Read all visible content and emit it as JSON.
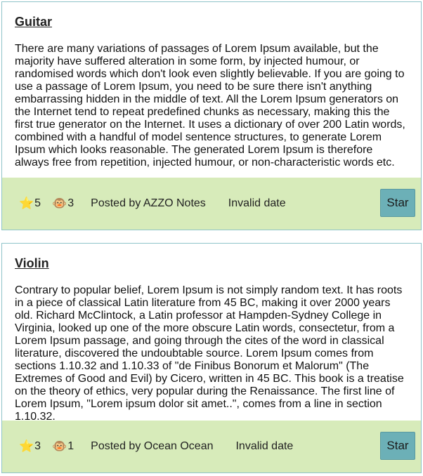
{
  "posts": [
    {
      "title": "Guitar",
      "body": "There are many variations of passages of Lorem Ipsum available, but the majority have suffered alteration in some form, by injected humour, or randomised words which don't look even slightly believable. If you are going to use a passage of Lorem Ipsum, you need to be sure there isn't anything embarrassing hidden in the middle of text. All the Lorem Ipsum generators on the Internet tend to repeat predefined chunks as necessary, making this the first true generator on the Internet. It uses a dictionary of over 200 Latin words, combined with a handful of model sentence structures, to generate Lorem Ipsum which looks reasonable. The generated Lorem Ipsum is therefore always free from repetition, injected humour, or non-characteristic words etc.",
      "star_emoji": "⭐",
      "stars": "5",
      "monkey_emoji": "🐵",
      "monkeys": "3",
      "posted_by": "Posted by AZZO Notes",
      "date": "Invalid date",
      "star_button": "Star"
    },
    {
      "title": "Violin",
      "body": "Contrary to popular belief, Lorem Ipsum is not simply random text. It has roots in a piece of classical Latin literature from 45 BC, making it over 2000 years old. Richard McClintock, a Latin professor at Hampden-Sydney College in Virginia, looked up one of the more obscure Latin words, consectetur, from a Lorem Ipsum passage, and going through the cites of the word in classical literature, discovered the undoubtable source. Lorem Ipsum comes from sections 1.10.32 and 1.10.33 of \"de Finibus Bonorum et Malorum\" (The Extremes of Good and Evil) by Cicero, written in 45 BC. This book is a treatise on the theory of ethics, very popular during the Renaissance. The first line of Lorem Ipsum, \"Lorem ipsum dolor sit amet..\", comes from a line in section 1.10.32.",
      "star_emoji": "⭐",
      "stars": "3",
      "monkey_emoji": "🐵",
      "monkeys": "1",
      "posted_by": "Posted by Ocean Ocean",
      "date": "Invalid date",
      "star_button": "Star"
    }
  ],
  "colors": {
    "card_border": "#8fc4c9",
    "footer_bg": "#d7ebba",
    "button_bg": "#6cb0b7"
  }
}
